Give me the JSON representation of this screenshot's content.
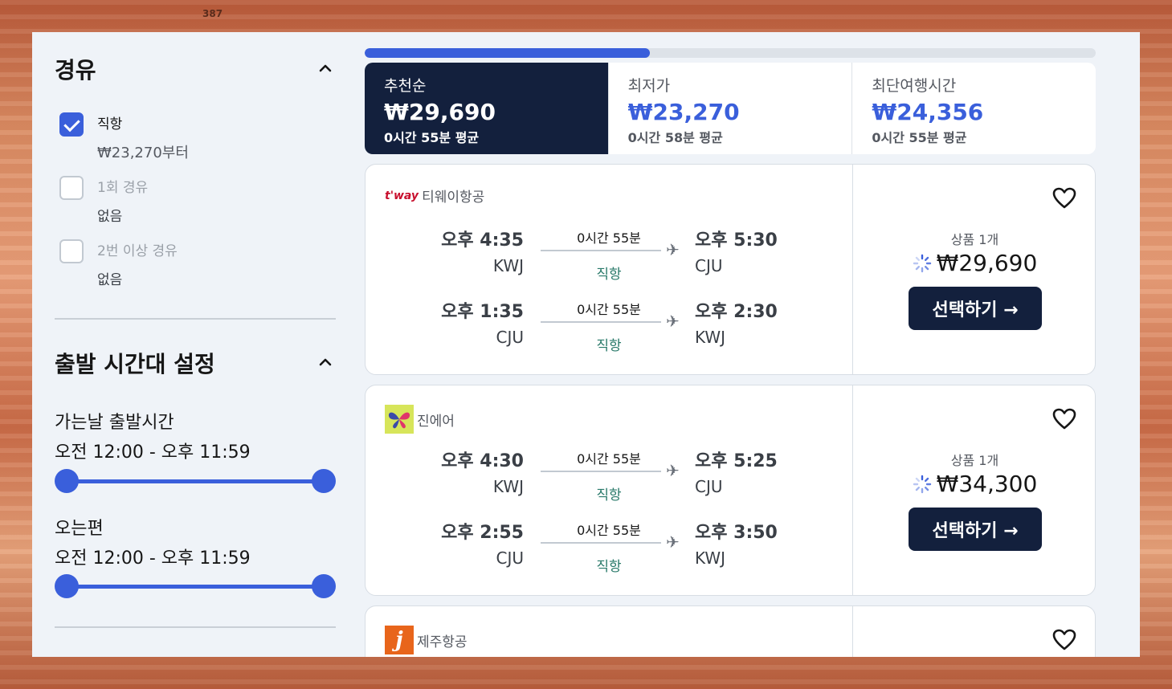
{
  "background_tag": "387",
  "stops": {
    "title": "경유",
    "options": [
      {
        "label": "직항",
        "sub": "₩23,270부터",
        "checked": true
      },
      {
        "label": "1회 경유",
        "sub": "없음",
        "checked": false
      },
      {
        "label": "2번 이상 경유",
        "sub": "없음",
        "checked": false
      }
    ]
  },
  "departure_time": {
    "title": "출발 시간대 설정",
    "outbound_label": "가는날 출발시간",
    "outbound_range": "오전 12:00 - 오후 11:59",
    "inbound_label": "오는편",
    "inbound_range": "오전 12:00 - 오후 11:59"
  },
  "progress": {
    "value": 0.39
  },
  "sort_tabs": [
    {
      "label": "추천순",
      "price": "₩29,690",
      "avg": "0시간 55분 평균",
      "active": true
    },
    {
      "label": "최저가",
      "price": "₩23,270",
      "avg": "0시간 58분 평균",
      "active": false
    },
    {
      "label": "최단여행시간",
      "price": "₩24,356",
      "avg": "0시간 55분 평균",
      "active": false
    }
  ],
  "results": [
    {
      "airline": "티웨이항공",
      "logo_text": "t'way",
      "legs": [
        {
          "dep_time": "오후 4:35",
          "dep_code": "KWJ",
          "duration": "0시간 55분",
          "stops": "직항",
          "arr_time": "오후 5:30",
          "arr_code": "CJU"
        },
        {
          "dep_time": "오후 1:35",
          "dep_code": "CJU",
          "duration": "0시간 55분",
          "stops": "직항",
          "arr_time": "오후 2:30",
          "arr_code": "KWJ"
        }
      ],
      "products": "상품 1개",
      "price": "₩29,690",
      "button": "선택하기 →"
    },
    {
      "airline": "진에어",
      "logo_text": "",
      "legs": [
        {
          "dep_time": "오후 4:30",
          "dep_code": "KWJ",
          "duration": "0시간 55분",
          "stops": "직항",
          "arr_time": "오후 5:25",
          "arr_code": "CJU"
        },
        {
          "dep_time": "오후 2:55",
          "dep_code": "CJU",
          "duration": "0시간 55분",
          "stops": "직항",
          "arr_time": "오후 3:50",
          "arr_code": "KWJ"
        }
      ],
      "products": "상품 1개",
      "price": "₩34,300",
      "button": "선택하기 →"
    },
    {
      "airline": "제주항공",
      "logo_text": "j"
    }
  ],
  "icons": {
    "chevron": "chevron-up-icon",
    "heart": "heart-icon",
    "plane": "plane-icon",
    "spinner": "loading-spinner-icon"
  },
  "colors": {
    "accent": "#3a5fdb",
    "navy": "#13203d",
    "direct_green": "#2a7a6a"
  }
}
